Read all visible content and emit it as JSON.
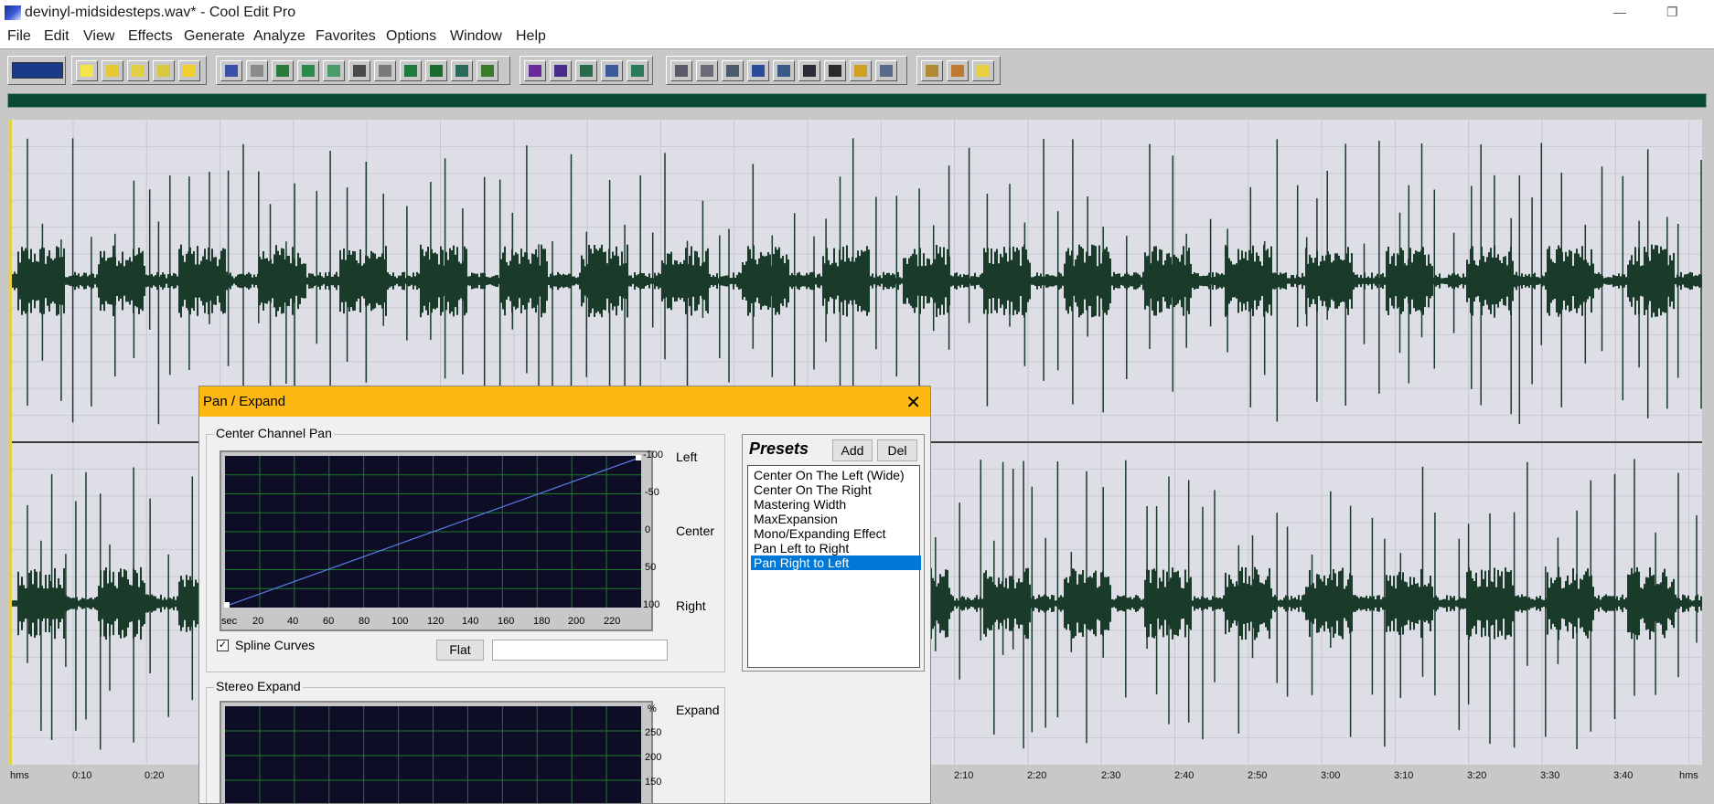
{
  "window": {
    "title": "devinyl-midsidesteps.wav* - Cool Edit Pro",
    "minimize_glyph": "—",
    "restore_glyph": "❐"
  },
  "menu": [
    "File",
    "Edit",
    "View",
    "Effects",
    "Generate",
    "Analyze",
    "Favorites",
    "Options",
    "Window",
    "Help"
  ],
  "timeline": {
    "unit_left": "hms",
    "unit_right": "hms",
    "ticks": [
      "0:10",
      "0:20",
      "2:10",
      "2:20",
      "2:30",
      "2:40",
      "2:50",
      "3:00",
      "3:10",
      "3:20",
      "3:30",
      "3:40"
    ]
  },
  "colors": {
    "waveform": "#1a3a2a",
    "background": "#dedfe6",
    "dialog_title": "#fdb813",
    "graph_bg": "#0d0d26",
    "graph_grid": "#1d7a2a",
    "graph_line": "#5a7ee8"
  },
  "dialog": {
    "title": "Pan / Expand",
    "close_glyph": "✕",
    "center_pan": {
      "group_title": "Center Channel Pan",
      "y_ticks": [
        "-100",
        "-50",
        "0",
        "50",
        "100"
      ],
      "x_unit": "sec",
      "x_ticks": [
        "20",
        "40",
        "60",
        "80",
        "100",
        "120",
        "140",
        "160",
        "180",
        "200",
        "220"
      ],
      "label_left": "Left",
      "label_center": "Center",
      "label_right": "Right",
      "spline_checked": true,
      "spline_label": "Spline Curves",
      "flat_button": "Flat"
    },
    "stereo_expand": {
      "group_title": "Stereo Expand",
      "y_unit": "%",
      "y_ticks": [
        "250",
        "200",
        "150"
      ],
      "label_expand": "Expand"
    },
    "presets": {
      "title": "Presets",
      "add_button": "Add",
      "del_button": "Del",
      "items": [
        "Center On The Left (Wide)",
        "Center On The Right",
        "Mastering Width",
        "MaxExpansion",
        "Mono/Expanding Effect",
        "Pan Left to Right",
        "Pan Right to Left"
      ],
      "selected_index": 6
    }
  }
}
